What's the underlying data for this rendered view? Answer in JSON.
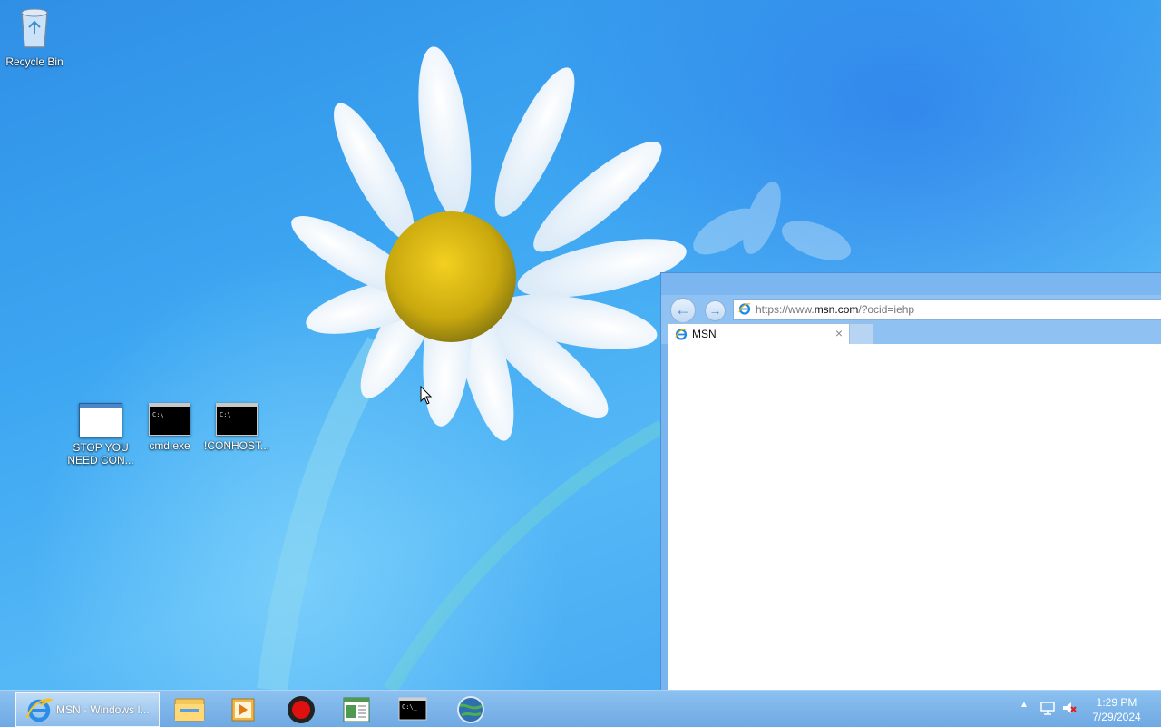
{
  "desktop": {
    "icons": [
      {
        "label": "Recycle Bin"
      },
      {
        "label": "STOP YOU NEED CON..."
      },
      {
        "label": "cmd.exe"
      },
      {
        "label": "!CONHOST..."
      }
    ],
    "cmd_glyph": "C:\\_"
  },
  "browser": {
    "nav": {
      "back": "←",
      "forward": "→"
    },
    "address": {
      "url_prefix": "https://www.",
      "url_domain": "msn.com",
      "url_suffix": "/?ocid=iehp"
    },
    "tabs": [
      {
        "title": "MSN",
        "close": "×"
      }
    ]
  },
  "taskbar": {
    "active_task_label": "MSN - Windows I...",
    "pinned": [
      {
        "icon": "file-explorer-icon"
      },
      {
        "icon": "media-player-icon"
      },
      {
        "icon": "record-icon"
      },
      {
        "icon": "notepad-icon"
      },
      {
        "icon": "command-prompt-icon"
      },
      {
        "icon": "network-globe-icon"
      }
    ],
    "tray": {
      "show_hidden": "▲",
      "time": "1:29 PM",
      "date": "7/29/2024"
    }
  },
  "colors": {
    "accent": "#3da7f2",
    "taskbar": "#7ab4ef",
    "window_frame": "#7cb6f1",
    "ie_blue": "#1e88e5"
  }
}
